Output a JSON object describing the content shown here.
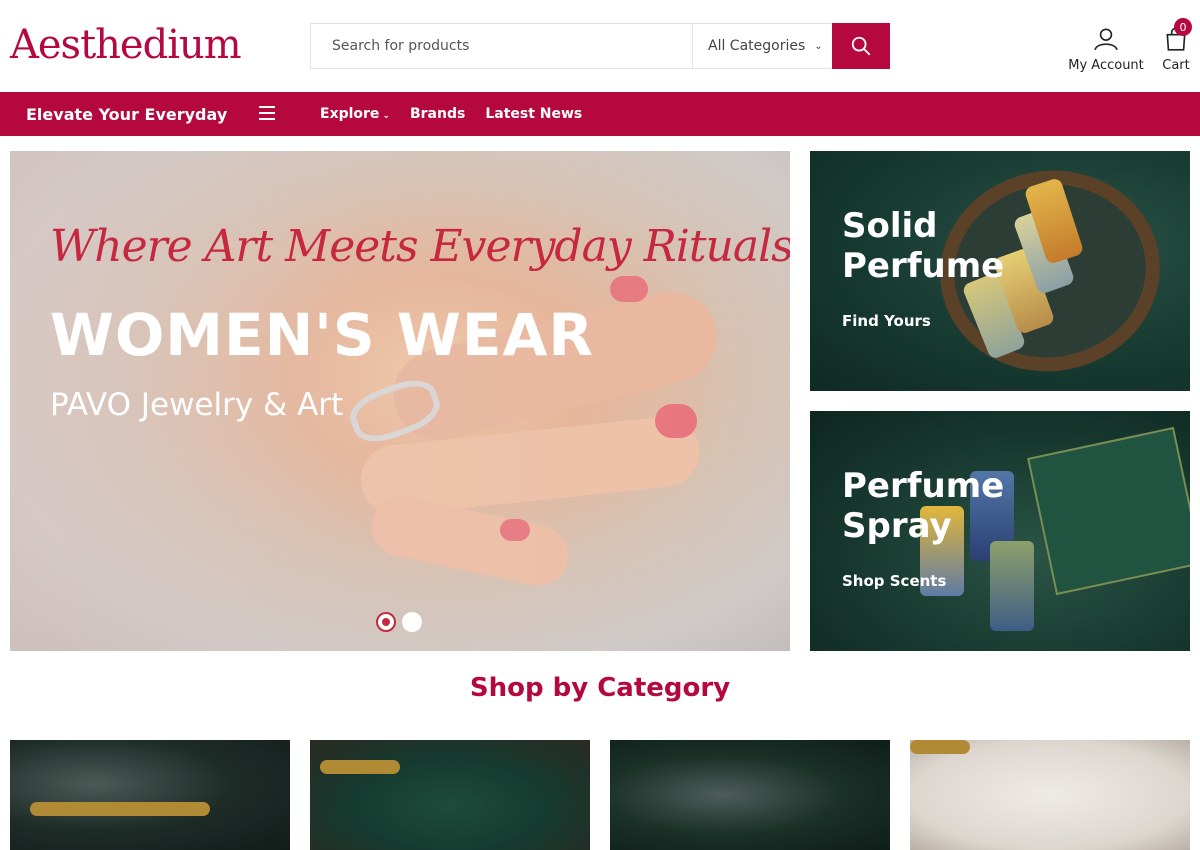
{
  "brand": {
    "logo_text": "Aesthedium",
    "accent": "#b5083f"
  },
  "search": {
    "placeholder": "Search for products",
    "category_selected": "All Categories"
  },
  "account": {
    "label": "My Account",
    "icon": "user-icon"
  },
  "cart": {
    "label": "Cart",
    "count": "0",
    "icon": "shopping-bag-icon"
  },
  "nav": {
    "tagline": "Elevate Your Everyday",
    "links": [
      {
        "label": "Explore",
        "has_dropdown": true
      },
      {
        "label": "Brands"
      },
      {
        "label": "Latest News"
      }
    ]
  },
  "hero": {
    "script_title": "Where Art Meets Everyday Rituals",
    "headline": "WOMEN'S WEAR",
    "subtitle": "PAVO Jewelry & Art",
    "slides_total": 2,
    "active_slide": 1
  },
  "banners": [
    {
      "title_line1": "Solid",
      "title_line2": "Perfume",
      "link": "Find Yours"
    },
    {
      "title_line1": "Perfume",
      "title_line2": "Spray",
      "link": "Shop Scents"
    }
  ],
  "categories": {
    "title": "Shop by Category"
  }
}
